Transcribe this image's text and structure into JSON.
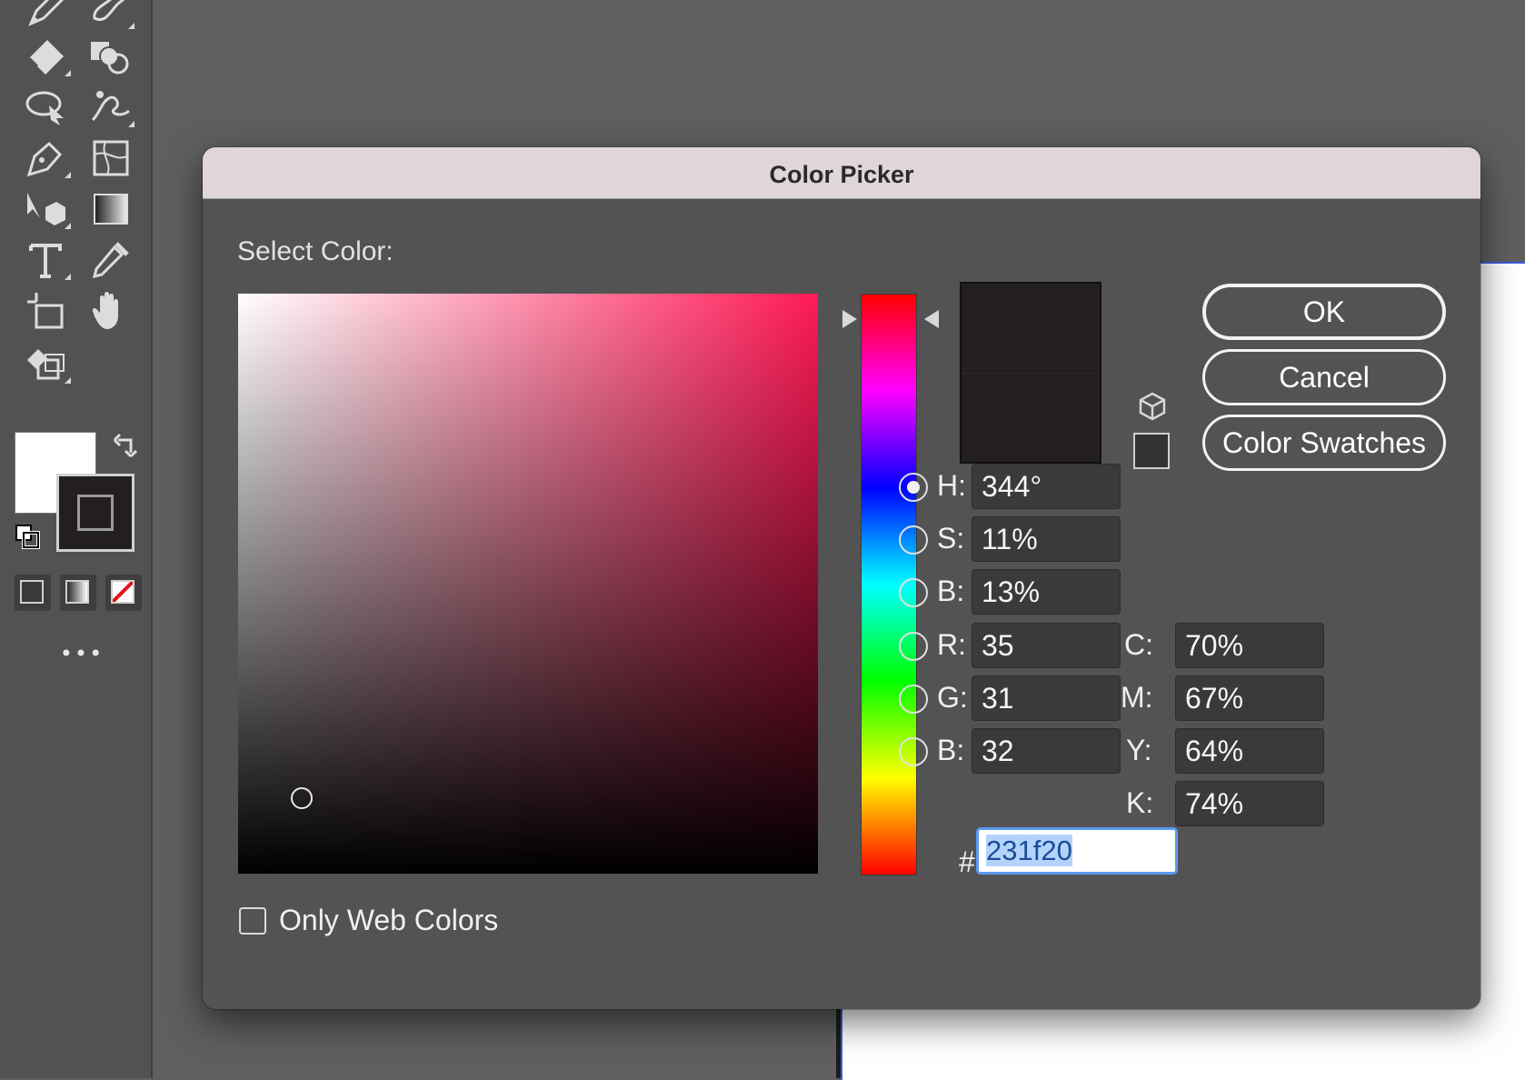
{
  "dialog": {
    "title": "Color Picker",
    "select_label": "Select Color:",
    "current_hex_color": "#231f20",
    "hue_field_color": "#ff1a57",
    "selection_position": {
      "saturation_fraction": 0.11,
      "brightness_fraction": 0.13
    },
    "buttons": {
      "ok": "OK",
      "cancel": "Cancel",
      "swatches": "Color Swatches"
    },
    "hsb": [
      {
        "label": "H:",
        "value": "344°",
        "selected": true
      },
      {
        "label": "S:",
        "value": "11%",
        "selected": false
      },
      {
        "label": "B:",
        "value": "13%",
        "selected": false
      }
    ],
    "rgb": [
      {
        "label": "R:",
        "value": "35",
        "selected": false
      },
      {
        "label": "G:",
        "value": "31",
        "selected": false
      },
      {
        "label": "B:",
        "value": "32",
        "selected": false
      }
    ],
    "cmyk": [
      {
        "label": "C:",
        "value": "70%"
      },
      {
        "label": "M:",
        "value": "67%"
      },
      {
        "label": "Y:",
        "value": "64%"
      },
      {
        "label": "K:",
        "value": "74%"
      }
    ],
    "hex": {
      "label": "#",
      "value": "231f20"
    },
    "only_web_colors": {
      "label": "Only Web Colors",
      "checked": false
    }
  },
  "toolbar": {
    "tools": [
      "pencil-icon",
      "blob-brush-icon",
      "eraser-icon",
      "shape-builder-icon",
      "lasso-icon",
      "puppet-warp-icon",
      "pen-icon",
      "mesh-icon",
      "perspective-selection-icon",
      "gradient-icon",
      "type-icon",
      "eyedropper-icon",
      "artboard-icon",
      "hand-icon",
      "live-paint-icon"
    ],
    "fill_color": "#ffffff",
    "stroke_color": "#231f20",
    "more_label": "•••"
  }
}
